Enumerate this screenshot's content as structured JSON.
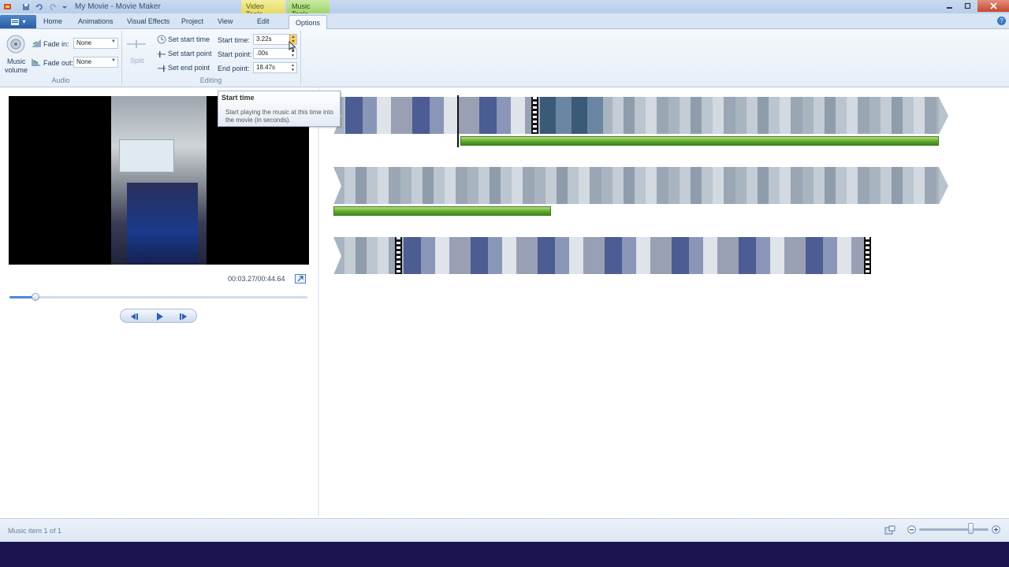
{
  "window": {
    "title": "My Movie - Movie Maker",
    "context_tabs": [
      "Video Tools",
      "Music Tools"
    ]
  },
  "tabs": {
    "file_menu_glyph": "▾",
    "items": [
      "Home",
      "Animations",
      "Visual Effects",
      "Project",
      "View",
      "Edit",
      "Options"
    ],
    "active": "Options"
  },
  "ribbon": {
    "audio": {
      "music_volume_label_1": "Music",
      "music_volume_label_2": "volume",
      "fade_in_label": "Fade in:",
      "fade_in_value": "None",
      "fade_out_label": "Fade out:",
      "fade_out_value": "None",
      "group_label": "Audio"
    },
    "editing": {
      "split_label": "Split",
      "set_start_time": "Set start time",
      "set_start_point": "Set start point",
      "set_end_point": "Set end point",
      "start_time_label": "Start time:",
      "start_time_value": "3.22s",
      "start_point_label": "Start point:",
      "start_point_value": ".00s",
      "end_point_label": "End point:",
      "end_point_value": "18.47s",
      "group_label": "Editing"
    }
  },
  "tooltip": {
    "title": "Start time",
    "body": "Start playing the music at this time into the movie (in seconds)."
  },
  "preview": {
    "timecode": "00:03.27/00:44.64",
    "seek_progress": 0.088
  },
  "statusbar": {
    "text": "Music item 1 of 1",
    "zoom_level": 0.75
  }
}
